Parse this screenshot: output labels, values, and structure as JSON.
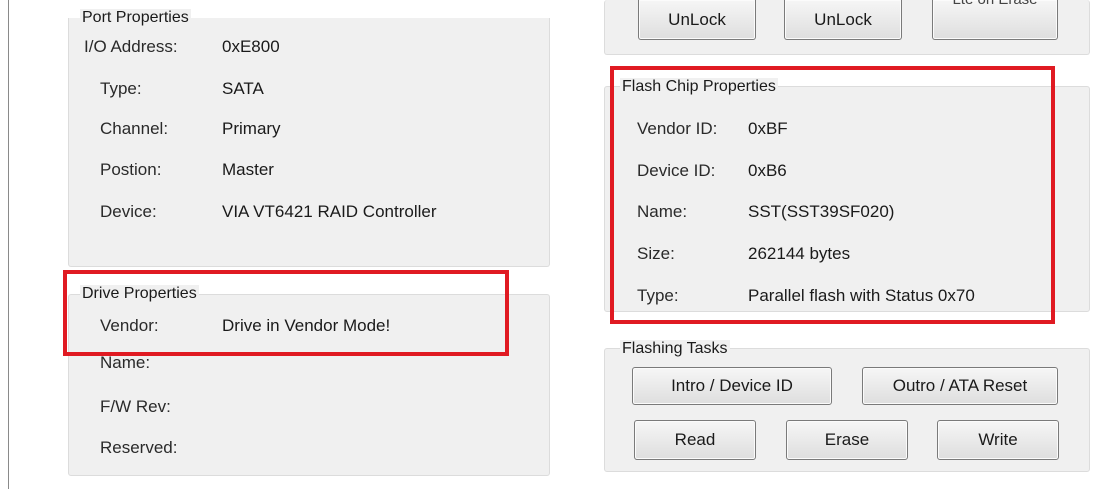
{
  "port": {
    "title": "Port Properties",
    "rows": [
      {
        "label": "I/O Address:",
        "value": "0xE800"
      },
      {
        "label": "Type:",
        "value": "SATA"
      },
      {
        "label": "Channel:",
        "value": "Primary"
      },
      {
        "label": "Postion:",
        "value": "Master"
      },
      {
        "label": "Device:",
        "value": "VIA VT6421 RAID Controller"
      }
    ]
  },
  "drive": {
    "title": "Drive Properties",
    "rows": [
      {
        "label": "Vendor:",
        "value": "Drive in Vendor Mode!"
      },
      {
        "label": "Name:",
        "value": ""
      },
      {
        "label": "F/W Rev:",
        "value": ""
      },
      {
        "label": "Reserved:",
        "value": ""
      }
    ]
  },
  "top_buttons": {
    "unlock1": "UnLock",
    "unlock2": "UnLock",
    "partial": "Lte on Erase"
  },
  "flash": {
    "title": "Flash Chip Properties",
    "rows": [
      {
        "label": "Vendor ID:",
        "value": "0xBF"
      },
      {
        "label": "Device ID:",
        "value": "0xB6"
      },
      {
        "label": "Name:",
        "value": "SST(SST39SF020)"
      },
      {
        "label": "Size:",
        "value": "262144 bytes"
      },
      {
        "label": "Type:",
        "value": "Parallel flash with Status 0x70"
      }
    ]
  },
  "tasks": {
    "title": "Flashing Tasks",
    "intro": "Intro / Device ID",
    "outro": "Outro / ATA Reset",
    "read": "Read",
    "erase": "Erase",
    "write": "Write"
  },
  "colors": {
    "highlight": "#e01a22",
    "panel": "#f0f0f0"
  }
}
